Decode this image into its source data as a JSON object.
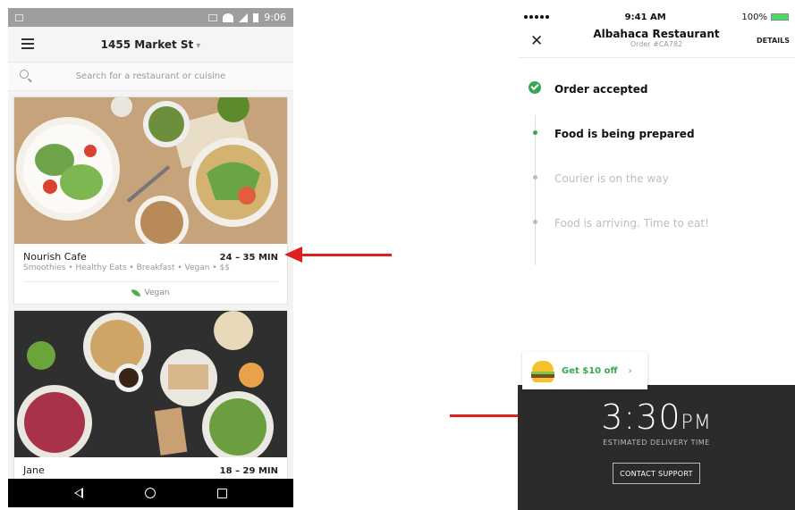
{
  "android": {
    "status": {
      "time": "9:06"
    },
    "topbar": {
      "address": "1455 Market St",
      "caret": "▾"
    },
    "search": {
      "placeholder": "Search for a restaurant or cuisine"
    },
    "restaurants": [
      {
        "name": "Nourish Cafe",
        "eta": "24 – 35 MIN",
        "tags": "Smoothies • Healthy Eats • Breakfast • Vegan • $$",
        "badge": "Vegan"
      },
      {
        "name": "Jane",
        "eta": "18 – 29 MIN"
      }
    ]
  },
  "iphone": {
    "status": {
      "time": "9:41 AM",
      "battery": "100%"
    },
    "header": {
      "close": "✕",
      "title": "Albahaca Restaurant",
      "subtitle": "Order #CA782",
      "details": "DETAILS"
    },
    "timeline": [
      {
        "label": "Order accepted",
        "state": "done"
      },
      {
        "label": "Food is being prepared",
        "state": "active"
      },
      {
        "label": "Courier is on the way",
        "state": "pending"
      },
      {
        "label": "Food is arriving. Time to eat!",
        "state": "pending"
      }
    ],
    "promo": {
      "label": "Get $10 off",
      "chevron": "›"
    },
    "eta": {
      "time": "3:30",
      "ampm": "PM",
      "label": "ESTIMATED DELIVERY TIME",
      "support": "CONTACT SUPPORT"
    }
  },
  "colors": {
    "arrow": "#e02020",
    "green": "#36a853",
    "dark_panel": "#2b2b2b"
  }
}
